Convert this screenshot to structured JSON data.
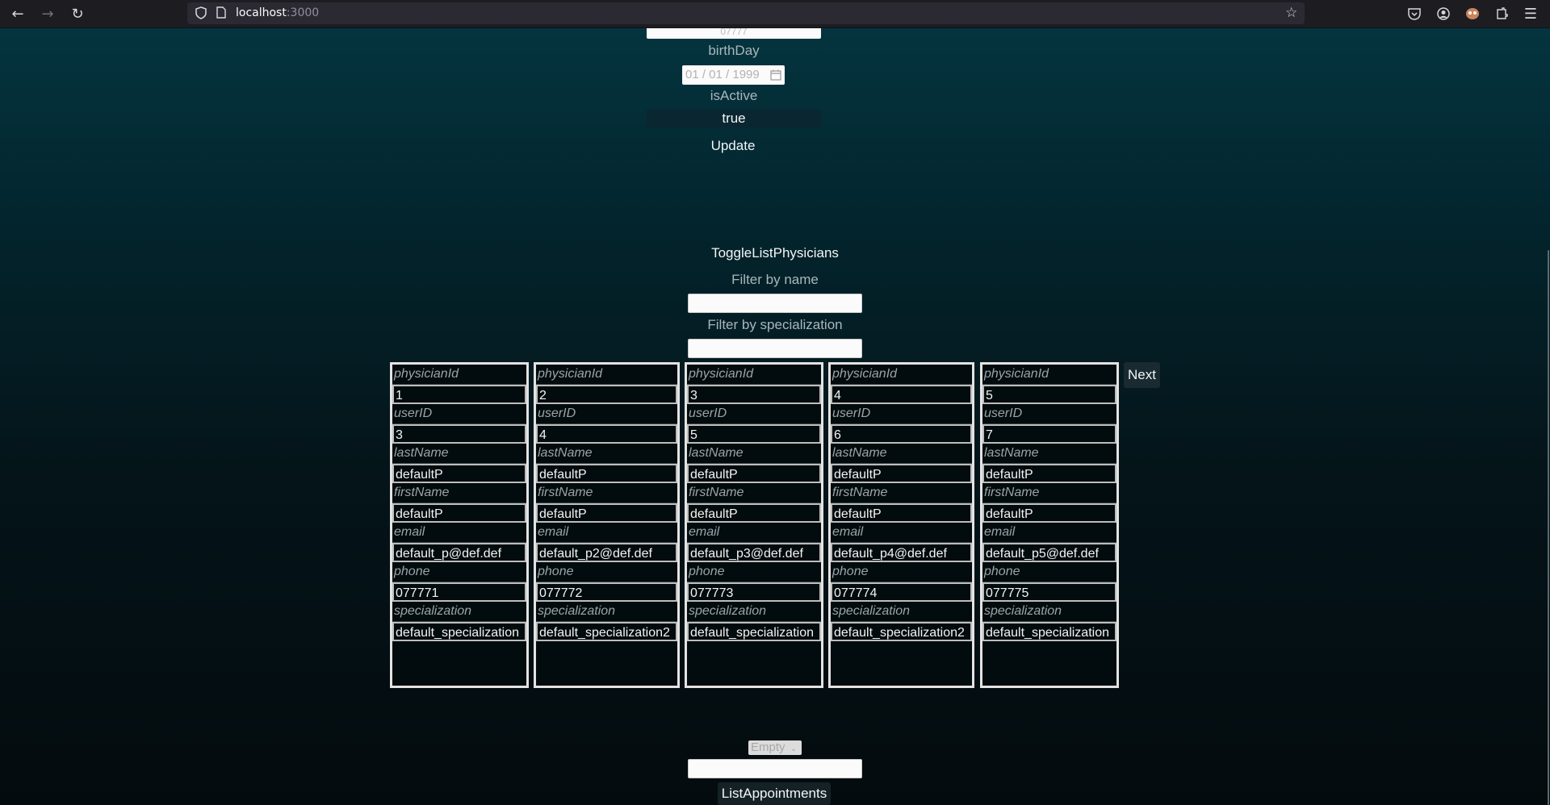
{
  "browser": {
    "url_host": "localhost",
    "url_port": ":3000",
    "icons": [
      "back-arrow-icon",
      "forward-arrow-icon",
      "reload-icon",
      "shield-icon",
      "page-icon",
      "bookmark-star-icon",
      "pocket-icon",
      "account-icon",
      "extension-avatar-icon",
      "extensions-icon",
      "menu-icon"
    ]
  },
  "form": {
    "top_stub_text": "07777",
    "birthday_label": "birthDay",
    "birthday_value": "01 / 01 / 1999",
    "isactive_label": "isActive",
    "isactive_value": "true",
    "update_label": "Update"
  },
  "physicians_section": {
    "toggle_label": "ToggleListPhysicians",
    "filter_name_label": "Filter by name",
    "filter_name_value": "",
    "filter_spec_label": "Filter by specialization",
    "filter_spec_value": "",
    "next_label": "Next",
    "field_labels": {
      "physicianId": "physicianId",
      "userID": "userID",
      "lastName": "lastName",
      "firstName": "firstName",
      "email": "email",
      "phone": "phone",
      "specialization": "specialization"
    },
    "physicians": [
      {
        "physicianId": "1",
        "userID": "3",
        "lastName": "defaultP",
        "firstName": "defaultP",
        "email": "default_p@def.def",
        "phone": "077771",
        "specialization": "default_specialization"
      },
      {
        "physicianId": "2",
        "userID": "4",
        "lastName": "defaultP",
        "firstName": "defaultP",
        "email": "default_p2@def.def",
        "phone": "077772",
        "specialization": "default_specialization2"
      },
      {
        "physicianId": "3",
        "userID": "5",
        "lastName": "defaultP",
        "firstName": "defaultP",
        "email": "default_p3@def.def",
        "phone": "077773",
        "specialization": "default_specialization"
      },
      {
        "physicianId": "4",
        "userID": "6",
        "lastName": "defaultP",
        "firstName": "defaultP",
        "email": "default_p4@def.def",
        "phone": "077774",
        "specialization": "default_specialization2"
      },
      {
        "physicianId": "5",
        "userID": "7",
        "lastName": "defaultP",
        "firstName": "defaultP",
        "email": "default_p5@def.def",
        "phone": "077775",
        "specialization": "default_specialization"
      }
    ]
  },
  "appointments": {
    "select_value": "Empty",
    "input_value": "",
    "list_label": "ListAppointments"
  }
}
